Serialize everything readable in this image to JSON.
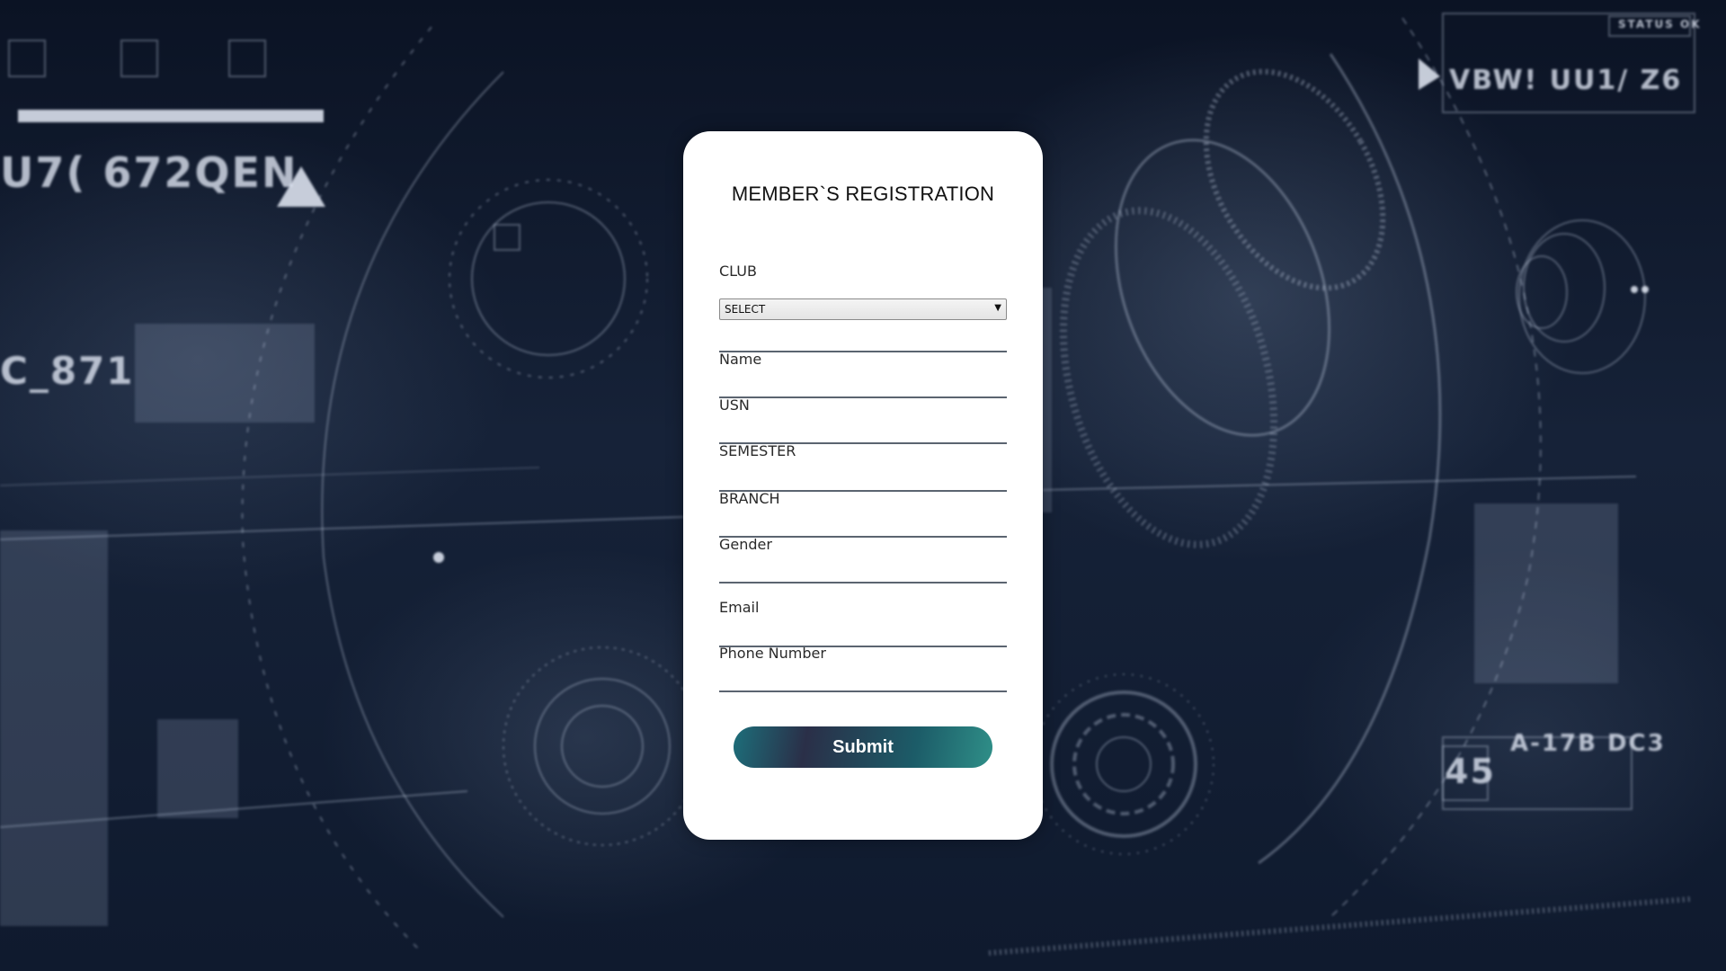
{
  "form": {
    "title": "MEMBER`S REGISTRATION",
    "club_label": "CLUB",
    "club_select_value": "SELECT",
    "fields": [
      {
        "label": "Name"
      },
      {
        "label": "USN"
      },
      {
        "label": "SEMESTER"
      },
      {
        "label": "BRANCH"
      },
      {
        "label": "Gender"
      },
      {
        "label": "Email"
      },
      {
        "label": "Phone Number"
      }
    ],
    "submit_label": "Submit"
  },
  "background": {
    "hud_texts": [
      "U7( 672QEN",
      "C_871",
      "VBW! UU1/ Z6",
      "STATUS OK",
      "45",
      "A-17B DC3"
    ]
  },
  "colors": {
    "background": "#0c1527",
    "card": "#ffffff",
    "button_gradient_start": "#1d6e7a",
    "button_gradient_mid": "#2a2f48",
    "button_gradient_end": "#2f8f88"
  }
}
